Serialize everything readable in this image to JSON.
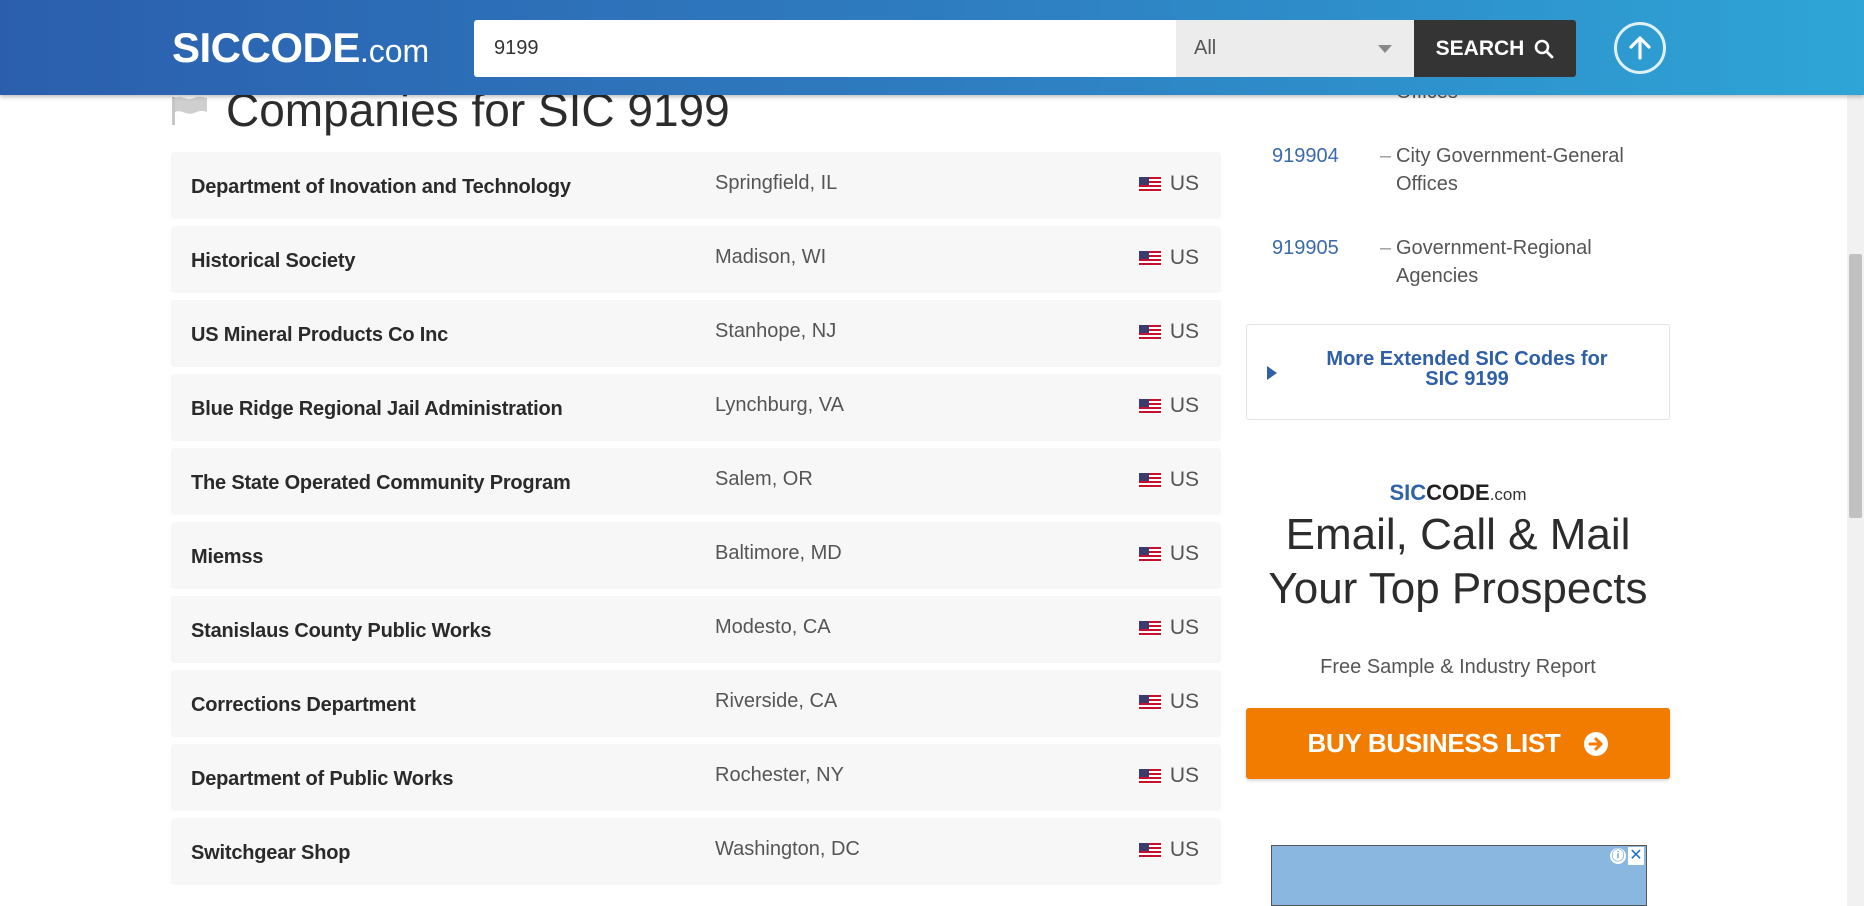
{
  "header": {
    "logo_brand": "SICCODE",
    "logo_tld": ".com",
    "search_value": "9199",
    "filter_selected": "All",
    "search_label": "SEARCH"
  },
  "main": {
    "title": "Companies for SIC 9199",
    "companies": [
      {
        "name": "Department of Inovation and Technology",
        "location": "Springfield, IL",
        "country": "US"
      },
      {
        "name": "Historical Society",
        "location": "Madison, WI",
        "country": "US"
      },
      {
        "name": "US Mineral Products Co Inc",
        "location": "Stanhope, NJ",
        "country": "US"
      },
      {
        "name": "Blue Ridge Regional Jail Administration",
        "location": "Lynchburg, VA",
        "country": "US"
      },
      {
        "name": "The State Operated Community Program",
        "location": "Salem, OR",
        "country": "US"
      },
      {
        "name": "Miemss",
        "location": "Baltimore, MD",
        "country": "US"
      },
      {
        "name": "Stanislaus County Public Works",
        "location": "Modesto, CA",
        "country": "US"
      },
      {
        "name": "Corrections Department",
        "location": "Riverside, CA",
        "country": "US"
      },
      {
        "name": "Department of Public Works",
        "location": "Rochester, NY",
        "country": "US"
      },
      {
        "name": "Switchgear Shop",
        "location": "Washington, DC",
        "country": "US"
      }
    ]
  },
  "sidebar": {
    "extended_codes": [
      {
        "code": "",
        "dash": "",
        "desc": "Offices"
      },
      {
        "code": "919904",
        "dash": "–",
        "desc": "City Government-General Offices"
      },
      {
        "code": "919905",
        "dash": "–",
        "desc": "Government-Regional Agencies"
      }
    ],
    "more_link": "More Extended SIC Codes for SIC 9199",
    "promo_logo_sic": "SIC",
    "promo_logo_code": "CODE",
    "promo_logo_tld": ".com",
    "promo_head_line1": "Email, Call & Mail",
    "promo_head_line2": "Your Top Prospects",
    "promo_sub": "Free Sample & Industry Report",
    "buy_label": "BUY BUSINESS LIST"
  },
  "colors": {
    "header_start": "#2b5fae",
    "header_end": "#2ea5d6",
    "link_blue": "#2f5fa6",
    "cta_orange": "#f27c00"
  }
}
